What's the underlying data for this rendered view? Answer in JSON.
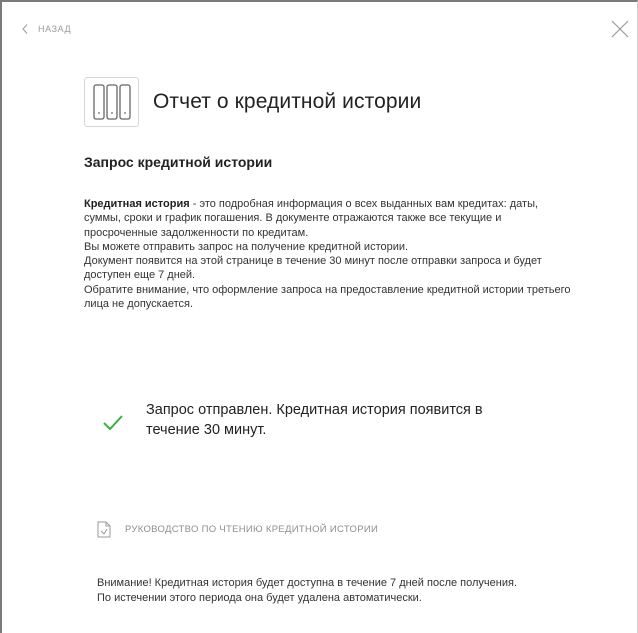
{
  "nav": {
    "back_label": "НАЗАД"
  },
  "header": {
    "title": "Отчет о кредитной истории",
    "icon": "document-columns-icon"
  },
  "section": {
    "title": "Запрос кредитной истории",
    "desc_bold": "Кредитная история",
    "desc_first": " - это подробная информация о всех выданных вам кредитах: даты, суммы, сроки и график погашения. В документе отражаются также все текущие и просроченные задолженности по кредитам.",
    "desc_lines": [
      "Вы можете отправить запрос на получение кредитной истории.",
      "Документ появится на этой странице в течение 30 минут после отправки запроса и будет доступен еще 7 дней.",
      "Обратите внимание, что оформление запроса на предоставление кредитной истории третьего лица не допускается."
    ]
  },
  "status": {
    "icon": "checkmark-icon",
    "color": "#3cb043",
    "text": "Запрос отправлен. Кредитная история появится в течение 30 минут."
  },
  "guide": {
    "icon": "document-icon",
    "label": "РУКОВОДСТВО ПО ЧТЕНИЮ КРЕДИТНОЙ ИСТОРИИ"
  },
  "notice": {
    "line1": "Внимание! Кредитная история будет доступна в течение 7 дней после получения.",
    "line2": "По истечении этого периода она будет удалена автоматически."
  }
}
